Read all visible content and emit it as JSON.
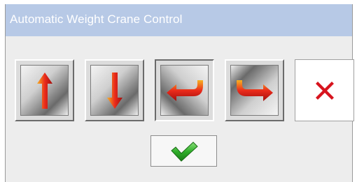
{
  "window": {
    "title": "Automatic Weight Crane Control"
  },
  "buttons": [
    {
      "name": "raise",
      "icon": "arrow-up-icon"
    },
    {
      "name": "lower",
      "icon": "arrow-down-icon"
    },
    {
      "name": "move-left",
      "icon": "arrow-curve-left-icon"
    },
    {
      "name": "move-right",
      "icon": "arrow-curve-right-icon"
    },
    {
      "name": "cancel",
      "icon": "close-icon"
    }
  ],
  "confirm": {
    "icon": "checkmark-icon"
  },
  "colors": {
    "titlebar": "#b7c9e6",
    "window_bg": "#ededed",
    "arrow_red": "#e8201a",
    "arrow_orange": "#f7b321",
    "cancel_red": "#d7141e",
    "check_green": "#2fae2a"
  }
}
